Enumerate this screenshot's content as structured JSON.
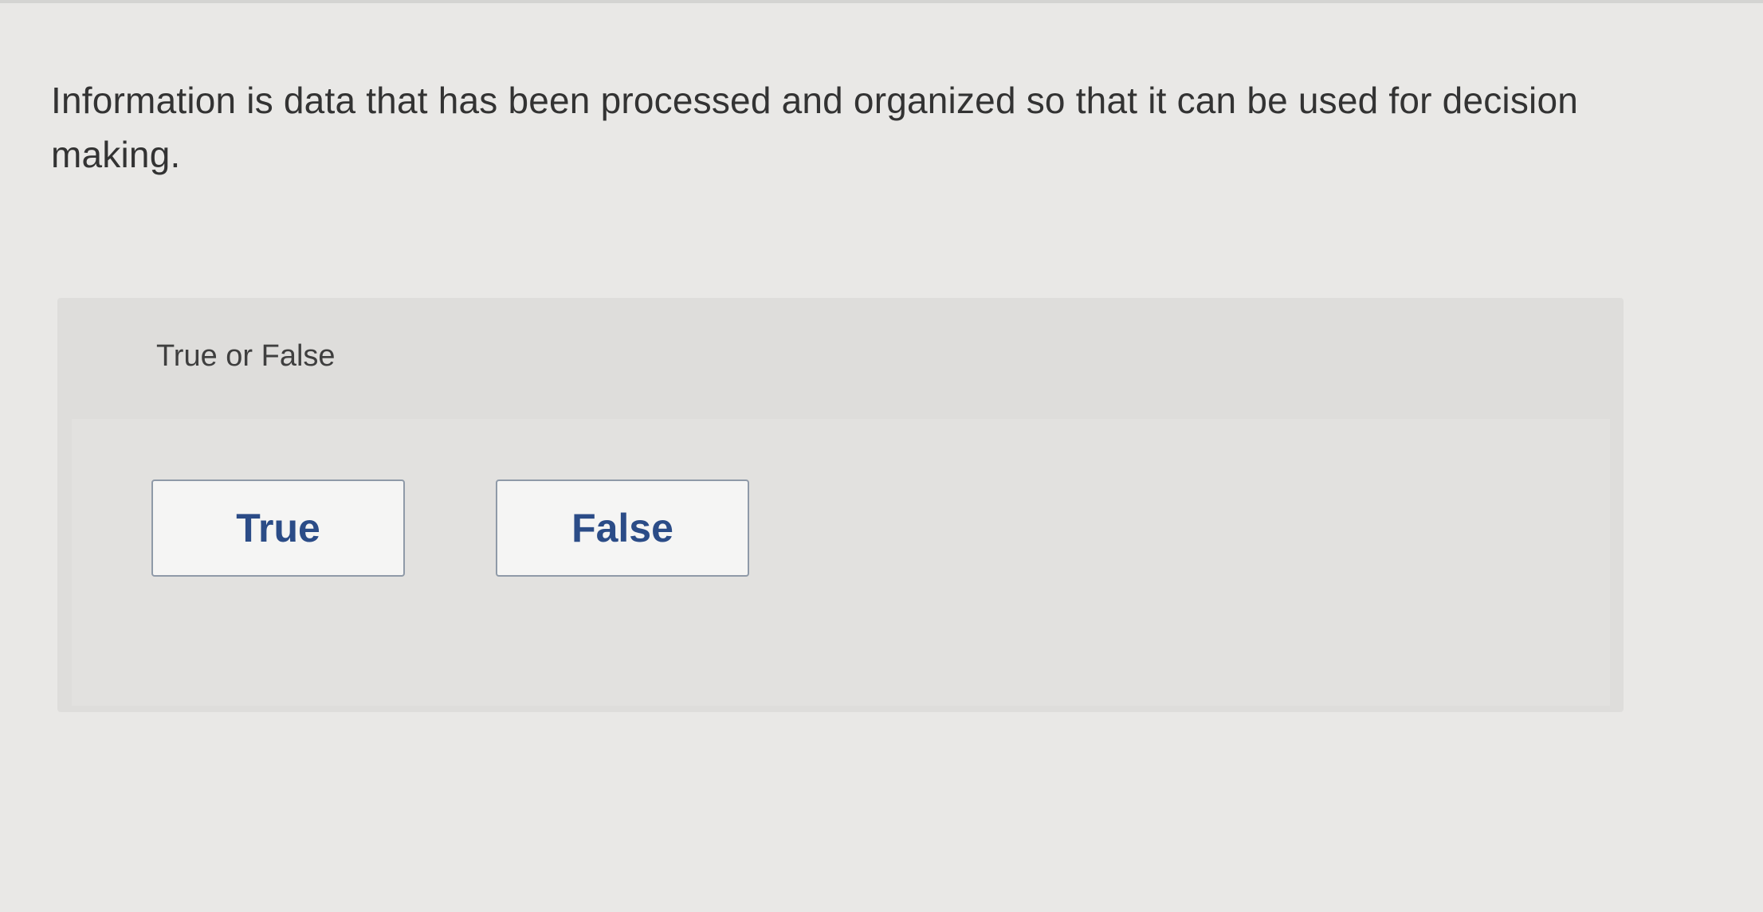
{
  "question": {
    "text": "Information is data that has been processed and organized so that it can be used for decision making."
  },
  "answer_panel": {
    "header": "True or False",
    "choices": [
      {
        "label": "True"
      },
      {
        "label": "False"
      }
    ]
  },
  "colors": {
    "choice_text": "#2b4c87",
    "choice_border": "#8f9aa8",
    "panel_background": "#dedddb",
    "page_background": "#e9e8e6"
  }
}
